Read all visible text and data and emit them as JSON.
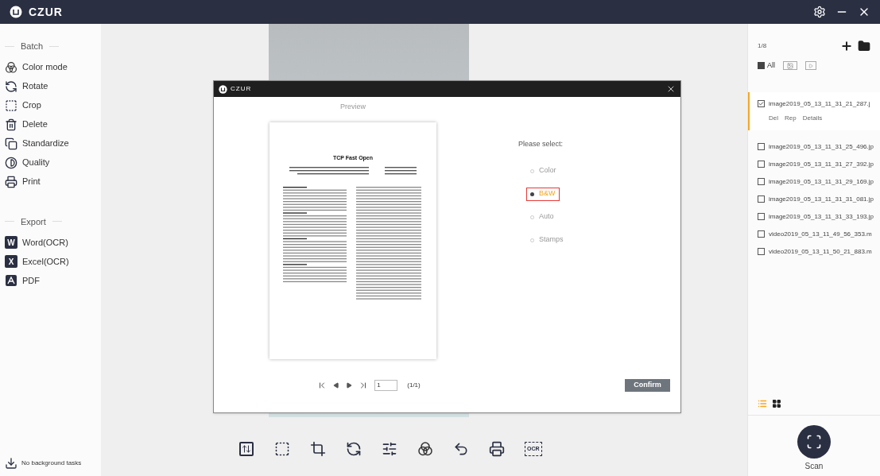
{
  "app": {
    "title": "CZUR"
  },
  "sidebar": {
    "sections": [
      {
        "title": "Batch",
        "items": [
          {
            "label": "Color mode",
            "kind": "colormode"
          },
          {
            "label": "Rotate",
            "kind": "rotate"
          },
          {
            "label": "Crop",
            "kind": "crop"
          },
          {
            "label": "Delete",
            "kind": "delete"
          },
          {
            "label": "Standardize",
            "kind": "standardize"
          },
          {
            "label": "Quality",
            "kind": "quality"
          },
          {
            "label": "Print",
            "kind": "print"
          }
        ]
      },
      {
        "title": "Export",
        "items": [
          {
            "label": "Word(OCR)",
            "kind": "word",
            "badge": "W"
          },
          {
            "label": "Excel(OCR)",
            "kind": "excel",
            "badge": "X"
          },
          {
            "label": "PDF",
            "kind": "pdf"
          }
        ]
      }
    ],
    "status": "No background tasks"
  },
  "toolbar": {
    "ocr_label": "OCR"
  },
  "dialog": {
    "title": "CZUR",
    "heading": "Preview",
    "document": {
      "title": "TCP Fast Open"
    },
    "pager": {
      "page": "1",
      "total": "(1/1)"
    },
    "prompt": "Please select:",
    "options": [
      {
        "label": "Color",
        "selected": false
      },
      {
        "label": "B&W",
        "selected": true
      },
      {
        "label": "Auto",
        "selected": false
      },
      {
        "label": "Stamps",
        "selected": false
      }
    ],
    "confirm": "Confirm"
  },
  "files": {
    "count": "1/8",
    "filters": [
      {
        "kind": "all",
        "label": "All",
        "selected": true
      },
      {
        "kind": "image",
        "selected": false
      },
      {
        "kind": "video",
        "selected": false
      }
    ],
    "items": [
      {
        "name": "image2019_05_13_11_31_21_287.j",
        "checked": true,
        "selected": true,
        "actions": [
          "Del",
          "Rep",
          "Details"
        ]
      },
      {
        "name": "image2019_05_13_11_31_25_496.jp",
        "checked": false,
        "selected": false
      },
      {
        "name": "image2019_05_13_11_31_27_392.jp",
        "checked": false,
        "selected": false
      },
      {
        "name": "image2019_05_13_11_31_29_169.jp",
        "checked": false,
        "selected": false
      },
      {
        "name": "image2019_05_13_11_31_31_081.jp",
        "checked": false,
        "selected": false
      },
      {
        "name": "image2019_05_13_11_31_33_193.jp",
        "checked": false,
        "selected": false
      },
      {
        "name": "video2019_05_13_11_49_56_353.m",
        "checked": false,
        "selected": false
      },
      {
        "name": "video2019_05_13_11_50_21_883.m",
        "checked": false,
        "selected": false
      }
    ]
  },
  "views": [
    {
      "kind": "list",
      "selected": true
    },
    {
      "kind": "grid",
      "selected": false
    }
  ],
  "scan": {
    "label": "Scan"
  }
}
